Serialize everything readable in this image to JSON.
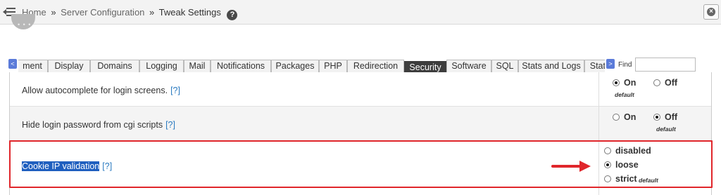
{
  "breadcrumb": {
    "home": "Home",
    "separator": "»",
    "section": "Server Configuration",
    "current": "Tweak Settings",
    "help_glyph": "?"
  },
  "tabs": [
    {
      "label": "ment",
      "active": false
    },
    {
      "label": "Display",
      "active": false
    },
    {
      "label": "Domains",
      "active": false
    },
    {
      "label": "Logging",
      "active": false
    },
    {
      "label": "Mail",
      "active": false
    },
    {
      "label": "Notifications",
      "active": false
    },
    {
      "label": "Packages",
      "active": false
    },
    {
      "label": "PHP",
      "active": false
    },
    {
      "label": "Redirection",
      "active": false
    },
    {
      "label": "Security",
      "active": true
    },
    {
      "label": "Software",
      "active": false
    },
    {
      "label": "SQL",
      "active": false
    },
    {
      "label": "Stats and Logs",
      "active": false
    },
    {
      "label": "Stats",
      "active": false
    }
  ],
  "tab_scroll": {
    "left": "<",
    "right": ">"
  },
  "find": {
    "label": "Find",
    "value": ""
  },
  "settings": [
    {
      "label": "Allow autocomplete for login screens.",
      "help": "[?]",
      "options": [
        {
          "label": "On",
          "checked": true,
          "default": true
        },
        {
          "label": "Off",
          "checked": false,
          "default": false
        }
      ]
    },
    {
      "label": "Hide login password from cgi scripts",
      "help": "[?]",
      "options": [
        {
          "label": "On",
          "checked": false,
          "default": false
        },
        {
          "label": "Off",
          "checked": true,
          "default": true
        }
      ]
    },
    {
      "label": "Cookie IP validation",
      "help": "[?]",
      "options": [
        {
          "label": "disabled",
          "checked": false,
          "default": false
        },
        {
          "label": "loose",
          "checked": true,
          "default": false
        },
        {
          "label": "strict",
          "checked": false,
          "default": true
        }
      ]
    }
  ],
  "default_text": "default",
  "colors": {
    "active_tab": "#3d3d3d",
    "highlight": "#1f5fbf",
    "callout": "#e0262b",
    "link": "#2a7ac0"
  },
  "icons": {
    "menu": "menu-collapse-icon",
    "help": "help-circle-icon",
    "close": "close-circle-icon"
  }
}
